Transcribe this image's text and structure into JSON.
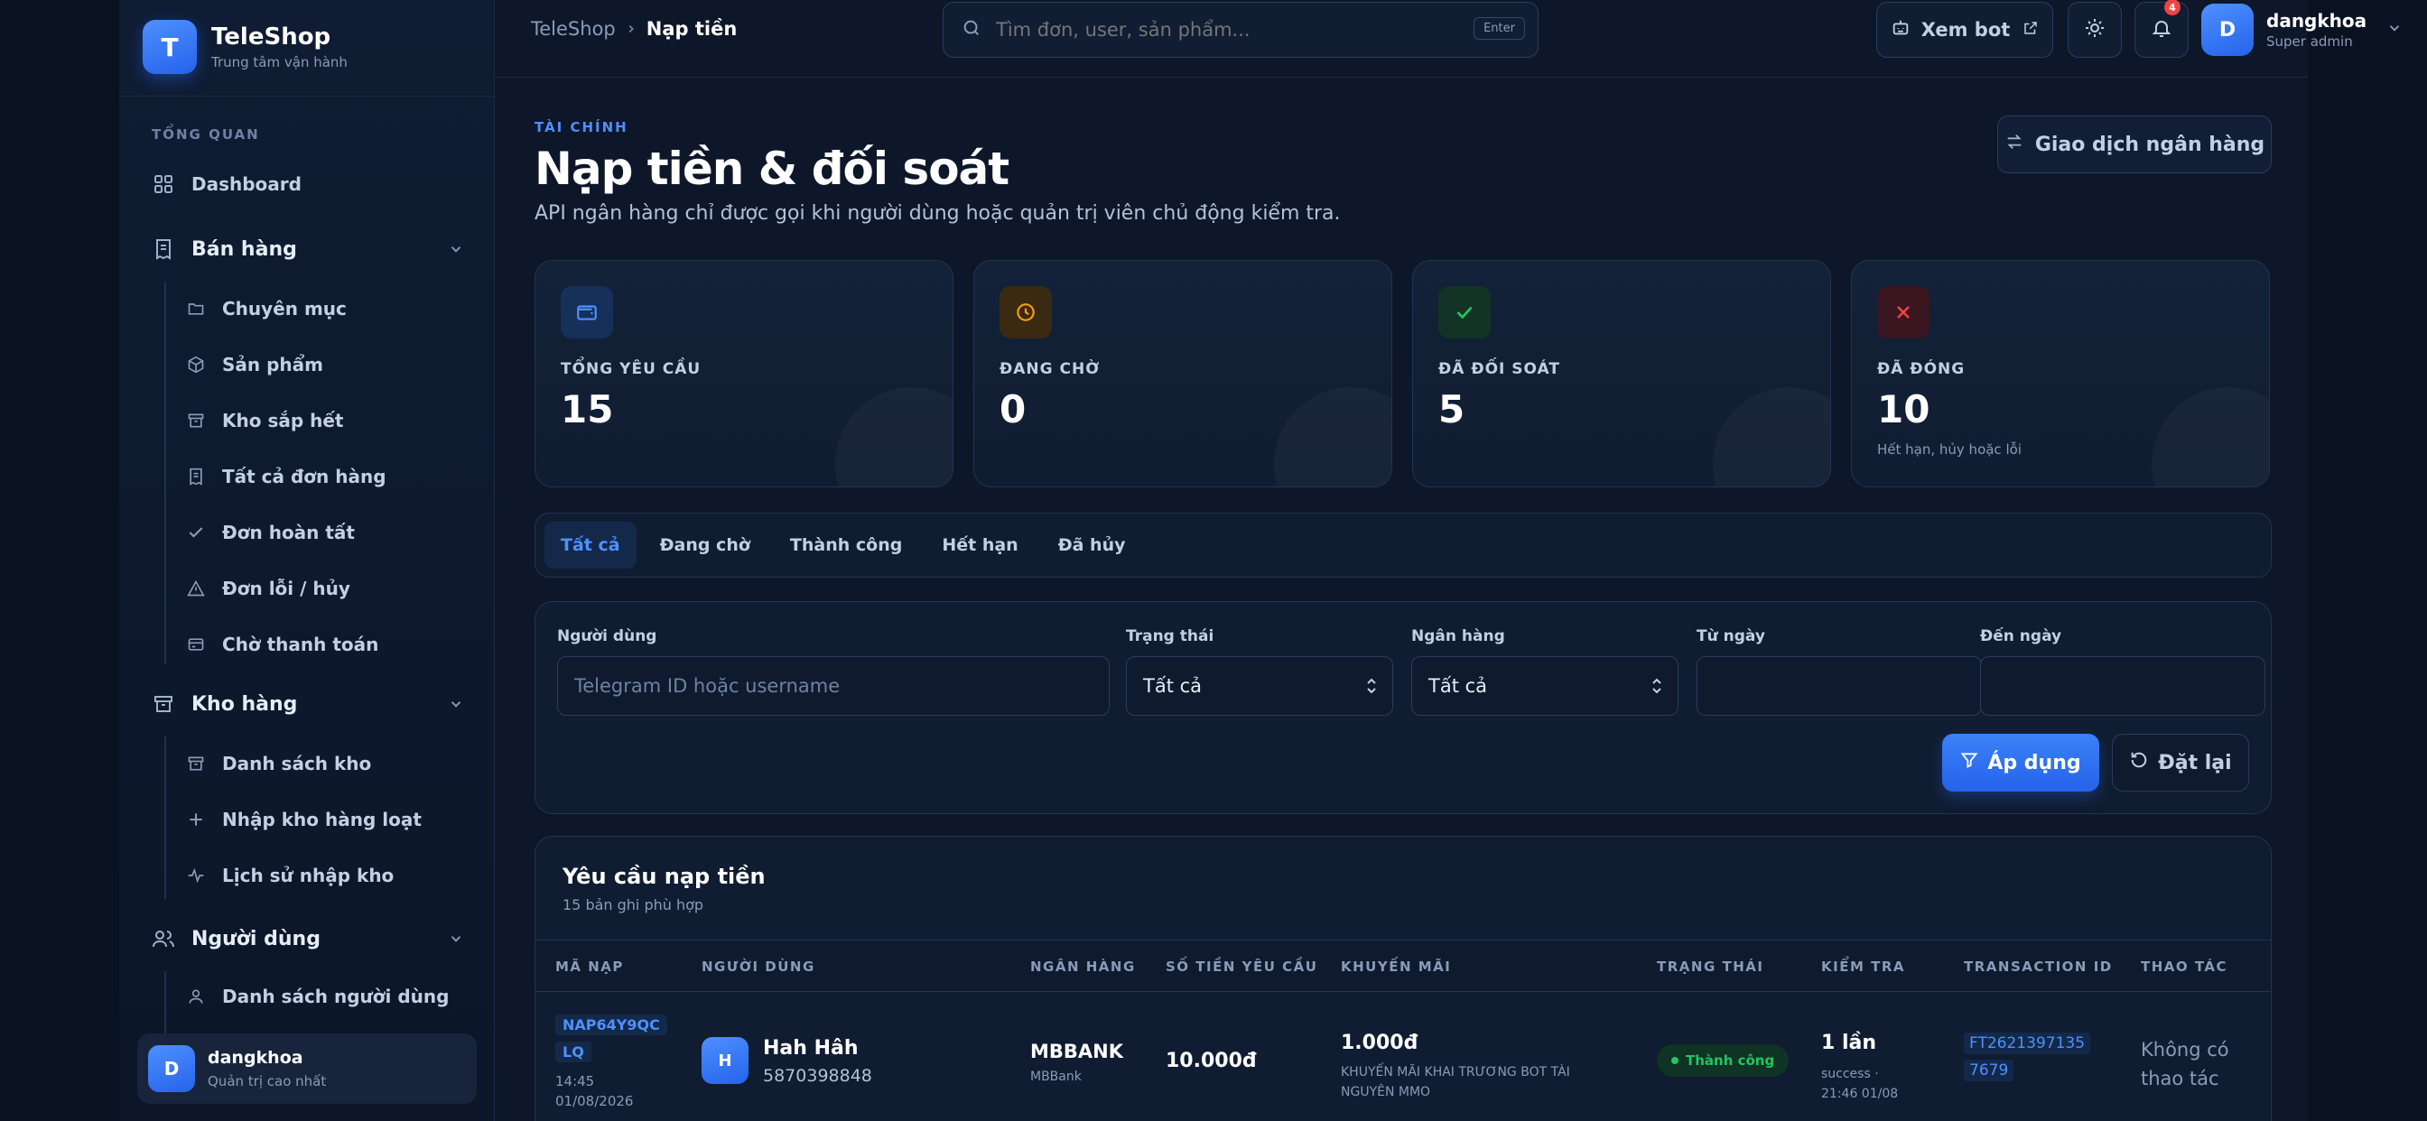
{
  "brand": {
    "logo_letter": "T",
    "name": "TeleShop",
    "subtitle": "Trung tâm vận hành"
  },
  "sidebar": {
    "section_label": "TỔNG QUAN",
    "dashboard": "Dashboard",
    "groups": [
      {
        "label": "Bán hàng",
        "items": [
          "Chuyên mục",
          "Sản phẩm",
          "Kho sắp hết",
          "Tất cả đơn hàng",
          "Đơn hoàn tất",
          "Đơn lỗi / hủy",
          "Chờ thanh toán"
        ]
      },
      {
        "label": "Kho hàng",
        "items": [
          "Danh sách kho",
          "Nhập kho hàng loạt",
          "Lịch sử nhập kho"
        ]
      },
      {
        "label": "Người dùng",
        "items": [
          "Danh sách người dùng"
        ]
      }
    ],
    "user": {
      "initial": "D",
      "name": "dangkhoa",
      "role": "Quản trị cao nhất"
    }
  },
  "topbar": {
    "breadcrumb": [
      "TeleShop",
      "Nạp tiền"
    ],
    "search_placeholder": "Tìm đơn, user, sản phẩm...",
    "search_hint": "Enter",
    "view_bot": "Xem bot",
    "notification_count": "4",
    "profile": {
      "initial": "D",
      "name": "dangkhoa",
      "role": "Super admin"
    }
  },
  "header": {
    "eyebrow": "TÀI CHÍNH",
    "title": "Nạp tiền & đối soát",
    "subtitle": "API ngân hàng chỉ được gọi khi người dùng hoặc quản trị viên chủ động kiểm tra.",
    "bank_button": "Giao dịch ngân hàng"
  },
  "stats": [
    {
      "label": "TỔNG YÊU CẦU",
      "value": "15",
      "note": "",
      "icon": "wallet-icon",
      "color": "#4e90ff",
      "bg": "#16305a"
    },
    {
      "label": "ĐANG CHỜ",
      "value": "0",
      "note": "",
      "icon": "clock-icon",
      "color": "#f59e0b",
      "bg": "#3a2a12"
    },
    {
      "label": "ĐÃ ĐỐI SOÁT",
      "value": "5",
      "note": "",
      "icon": "check-icon",
      "color": "#22c55e",
      "bg": "#123326"
    },
    {
      "label": "ĐÃ ĐÓNG",
      "value": "10",
      "note": "Hết hạn, hủy hoặc lỗi",
      "icon": "x-icon",
      "color": "#ef4444",
      "bg": "#3a1620"
    }
  ],
  "tabs": [
    "Tất cả",
    "Đang chờ",
    "Thành công",
    "Hết hạn",
    "Đã hủy"
  ],
  "filters": {
    "user_label": "Người dùng",
    "user_placeholder": "Telegram ID hoặc username",
    "status_label": "Trạng thái",
    "status_value": "Tất cả",
    "bank_label": "Ngân hàng",
    "bank_value": "Tất cả",
    "from_label": "Từ ngày",
    "to_label": "Đến ngày",
    "apply": "Áp dụng",
    "reset": "Đặt lại"
  },
  "table": {
    "title": "Yêu cầu nạp tiền",
    "subtitle": "15 bản ghi phù hợp",
    "columns": [
      "MÃ NẠP",
      "NGƯỜI DÙNG",
      "NGÂN HÀNG",
      "SỐ TIỀN YÊU CẦU",
      "KHUYẾN MÃI",
      "TRẠNG THÁI",
      "KIỂM TRA",
      "TRANSACTION ID",
      "THAO TÁC"
    ],
    "rows": [
      {
        "code_line1": "NAP64Y9QC",
        "code_line2": "LQ",
        "time": "14:45",
        "date": "01/08/2026",
        "user_initial": "H",
        "user_name": "Hah Hâh",
        "user_id": "5870398848",
        "bank": "MBBANK",
        "bank_sub": "MBBank",
        "amount": "10.000đ",
        "promo": "1.000đ",
        "promo_desc": "KHUYẾN MÃI KHAI TRƯƠNG BOT TÀI NGUYÊN MMO",
        "status": "Thành công",
        "check": "1 lần",
        "check_sub1": "success ·",
        "check_sub2": "21:46 01/08",
        "txn_line1": "FT2621397135",
        "txn_line2": "7679",
        "action_line1": "Không có",
        "action_line2": "thao tác"
      }
    ]
  }
}
